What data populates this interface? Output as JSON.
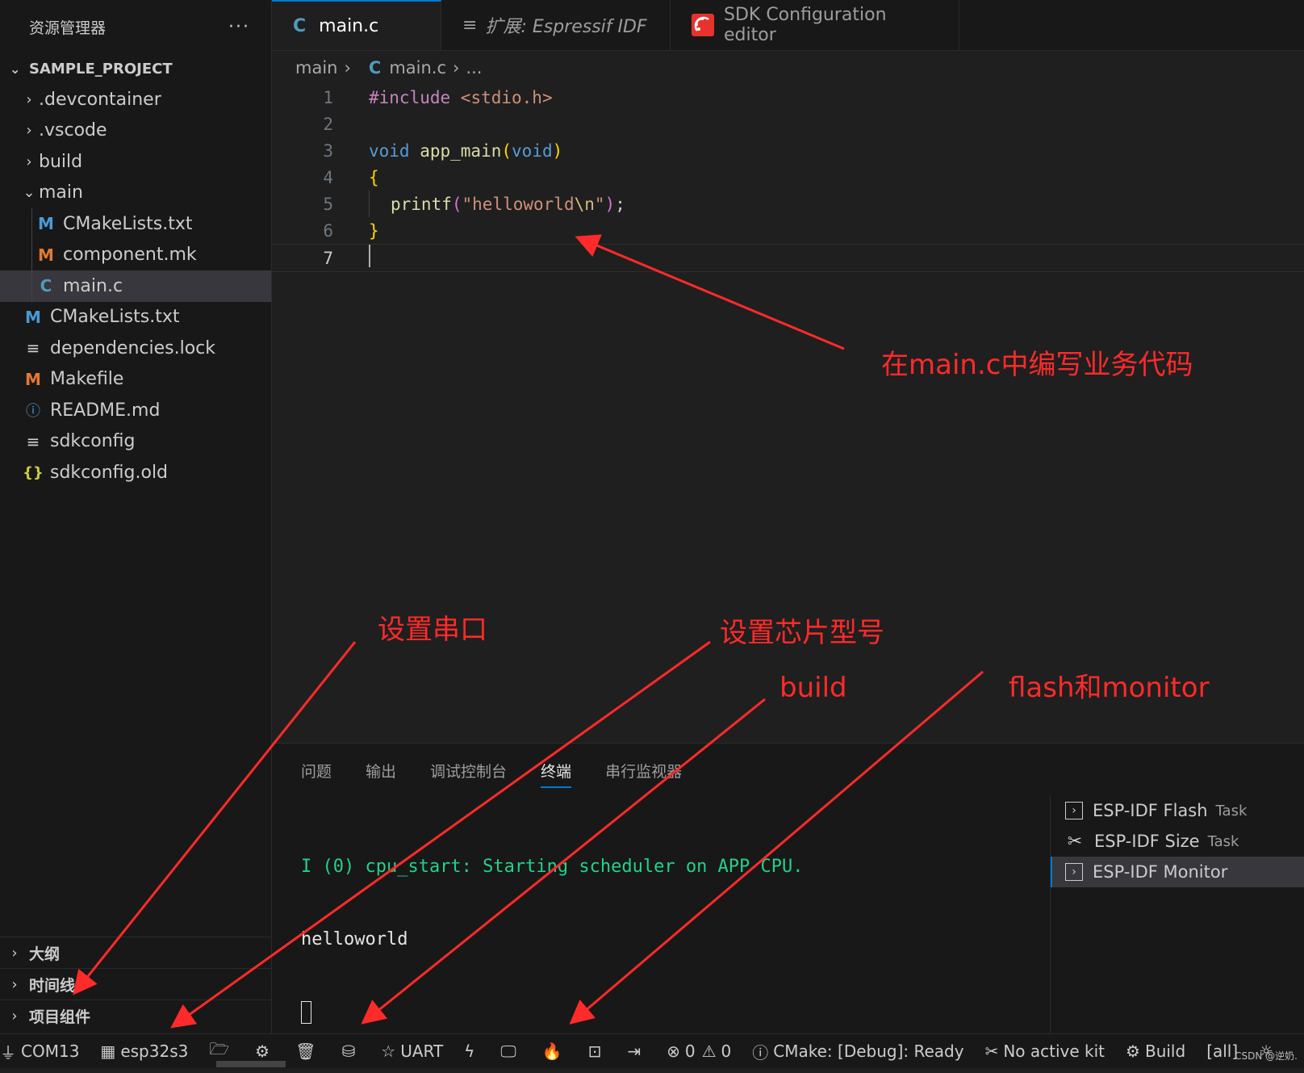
{
  "explorer": {
    "title": "资源管理器",
    "more": "···",
    "project": "SAMPLE_PROJECT",
    "items": [
      {
        "name": ".devcontainer",
        "type": "folder",
        "state": "collapsed",
        "icon": "chevron-right"
      },
      {
        "name": ".vscode",
        "type": "folder",
        "state": "collapsed",
        "icon": "chevron-right"
      },
      {
        "name": "build",
        "type": "folder",
        "state": "collapsed",
        "icon": "chevron-right"
      },
      {
        "name": "main",
        "type": "folder",
        "state": "expanded",
        "icon": "chevron-down"
      },
      {
        "name": "CMakeLists.txt",
        "type": "file",
        "icon_glyph": "M",
        "icon": "cmake-icon"
      },
      {
        "name": "component.mk",
        "type": "file",
        "icon_glyph": "M",
        "icon": "makefile-icon"
      },
      {
        "name": "main.c",
        "type": "file",
        "icon_glyph": "C",
        "icon": "c-file-icon",
        "selected": true
      },
      {
        "name": "CMakeLists.txt",
        "type": "file",
        "icon_glyph": "M",
        "icon": "cmake-icon"
      },
      {
        "name": "dependencies.lock",
        "type": "file",
        "icon_glyph": "≡",
        "icon": "text-file-icon"
      },
      {
        "name": "Makefile",
        "type": "file",
        "icon_glyph": "M",
        "icon": "makefile-icon"
      },
      {
        "name": "README.md",
        "type": "file",
        "icon_glyph": "ⓘ",
        "icon": "info-icon"
      },
      {
        "name": "sdkconfig",
        "type": "file",
        "icon_glyph": "≡",
        "icon": "text-file-icon"
      },
      {
        "name": "sdkconfig.old",
        "type": "file",
        "icon_glyph": "{}",
        "icon": "json-icon"
      }
    ],
    "sections": [
      "大纲",
      "时间线",
      "项目组件"
    ]
  },
  "tabs": [
    {
      "label": "main.c",
      "icon": "C",
      "active": true,
      "modified": true
    },
    {
      "label": "扩展: Espressif IDF",
      "icon": "≡",
      "active": false
    },
    {
      "label": "SDK Configuration editor",
      "icon": "espressif-icon",
      "active": false
    }
  ],
  "breadcrumb": {
    "folder": "main",
    "file_icon": "C",
    "file": "main.c",
    "more": "..."
  },
  "editor": {
    "line_numbers": [
      "1",
      "2",
      "3",
      "4",
      "5",
      "6",
      "7"
    ],
    "lines": {
      "l1_directive": "#include",
      "l1_header": " <stdio.h>",
      "l3_void": "void",
      "l3_fn": " app_main",
      "l3_open": "(",
      "l3_param": "void",
      "l3_close": ")",
      "l4": "{",
      "l5_fn": "printf",
      "l5_open": "(",
      "l5_str": "\"helloworld",
      "l5_esc": "\\n",
      "l5_strend": "\"",
      "l5_close": ")",
      "l5_semi": ";",
      "l6": "}"
    }
  },
  "panel": {
    "tabs": [
      "问题",
      "输出",
      "调试控制台",
      "终端",
      "串行监视器"
    ],
    "active_tab": "终端",
    "terminal": {
      "line1": "I (0) cpu_start: Starting scheduler on APP CPU.",
      "line2": "helloworld"
    },
    "tasks": [
      {
        "label": "ESP-IDF Flash",
        "sub": "Task",
        "icon": "terminal-icon"
      },
      {
        "label": "ESP-IDF Size",
        "sub": "Task",
        "icon": "tools-icon"
      },
      {
        "label": "ESP-IDF Monitor",
        "sub": "",
        "icon": "terminal-icon",
        "selected": true
      }
    ]
  },
  "statusbar": {
    "port": "COM13",
    "chip": "esp32s3",
    "uart": "UART",
    "errors": "0",
    "warnings": "0",
    "cmake": "CMake: [Debug]: Ready",
    "kit": "No active kit",
    "build": "Build",
    "target": "[all]"
  },
  "annotations": {
    "code": "在main.c中编写业务代码",
    "port": "设置串口",
    "chip": "设置芯片型号",
    "build": "build",
    "flash": "flash和monitor"
  },
  "watermark": "CSDN @逆奶.",
  "colors": {
    "accent": "#0078d4",
    "annotation": "#ff2a2a",
    "terminal_green": "#23d18b"
  }
}
